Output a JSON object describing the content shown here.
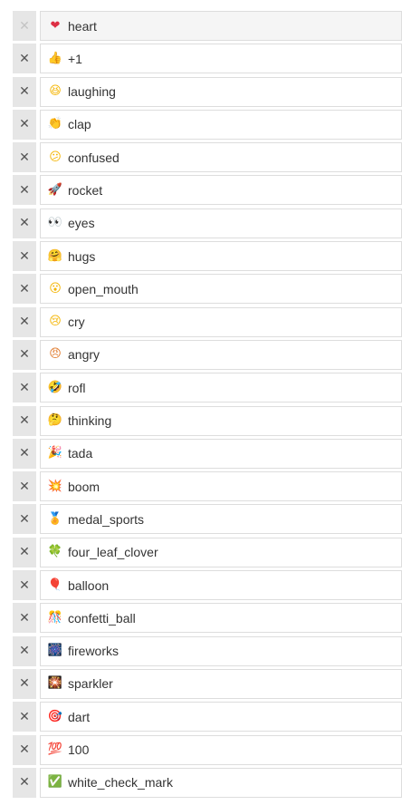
{
  "remove_symbol": "✕",
  "items": [
    {
      "name": "heart",
      "glyph": "❤",
      "color": "#dd2e44",
      "icon": "heart-icon",
      "remove_disabled": true,
      "active": true
    },
    {
      "name": "+1",
      "glyph": "👍",
      "color": "#f4b400",
      "icon": "thumbs-up-icon"
    },
    {
      "name": "laughing",
      "glyph": "😆",
      "color": "#f4b400",
      "icon": "laughing-face-icon"
    },
    {
      "name": "clap",
      "glyph": "👏",
      "color": "#f4b400",
      "icon": "clapping-hands-icon"
    },
    {
      "name": "confused",
      "glyph": "😕",
      "color": "#f4b400",
      "icon": "confused-face-icon"
    },
    {
      "name": "rocket",
      "glyph": "🚀",
      "color": "#5b7fa8",
      "icon": "rocket-icon"
    },
    {
      "name": "eyes",
      "glyph": "👀",
      "color": "#333333",
      "icon": "eyes-icon"
    },
    {
      "name": "hugs",
      "glyph": "🤗",
      "color": "#f4b400",
      "icon": "hugging-face-icon"
    },
    {
      "name": "open_mouth",
      "glyph": "😮",
      "color": "#f4b400",
      "icon": "open-mouth-face-icon"
    },
    {
      "name": "cry",
      "glyph": "😢",
      "color": "#f4b400",
      "icon": "crying-face-icon"
    },
    {
      "name": "angry",
      "glyph": "😠",
      "color": "#e07a2c",
      "icon": "angry-face-icon"
    },
    {
      "name": "rofl",
      "glyph": "🤣",
      "color": "#f4b400",
      "icon": "rofl-face-icon"
    },
    {
      "name": "thinking",
      "glyph": "🤔",
      "color": "#f4b400",
      "icon": "thinking-face-icon"
    },
    {
      "name": "tada",
      "glyph": "🎉",
      "color": "#c2185b",
      "icon": "party-popper-icon"
    },
    {
      "name": "boom",
      "glyph": "💥",
      "color": "#e53935",
      "icon": "collision-icon"
    },
    {
      "name": "medal_sports",
      "glyph": "🏅",
      "color": "#e0a000",
      "icon": "sports-medal-icon"
    },
    {
      "name": "four_leaf_clover",
      "glyph": "🍀",
      "color": "#43a047",
      "icon": "four-leaf-clover-icon"
    },
    {
      "name": "balloon",
      "glyph": "🎈",
      "color": "#d32f2f",
      "icon": "balloon-icon"
    },
    {
      "name": "confetti_ball",
      "glyph": "🎊",
      "color": "#e53935",
      "icon": "confetti-ball-icon"
    },
    {
      "name": "fireworks",
      "glyph": "🎆",
      "color": "#1e3a5f",
      "icon": "fireworks-icon"
    },
    {
      "name": "sparkler",
      "glyph": "🎇",
      "color": "#1e3a5f",
      "icon": "sparkler-icon"
    },
    {
      "name": "dart",
      "glyph": "🎯",
      "color": "#c62828",
      "icon": "dart-icon"
    },
    {
      "name": "100",
      "glyph": "💯",
      "color": "#d32f2f",
      "icon": "hundred-points-icon"
    },
    {
      "name": "white_check_mark",
      "glyph": "✅",
      "color": "#43a047",
      "icon": "check-mark-button-icon"
    }
  ]
}
